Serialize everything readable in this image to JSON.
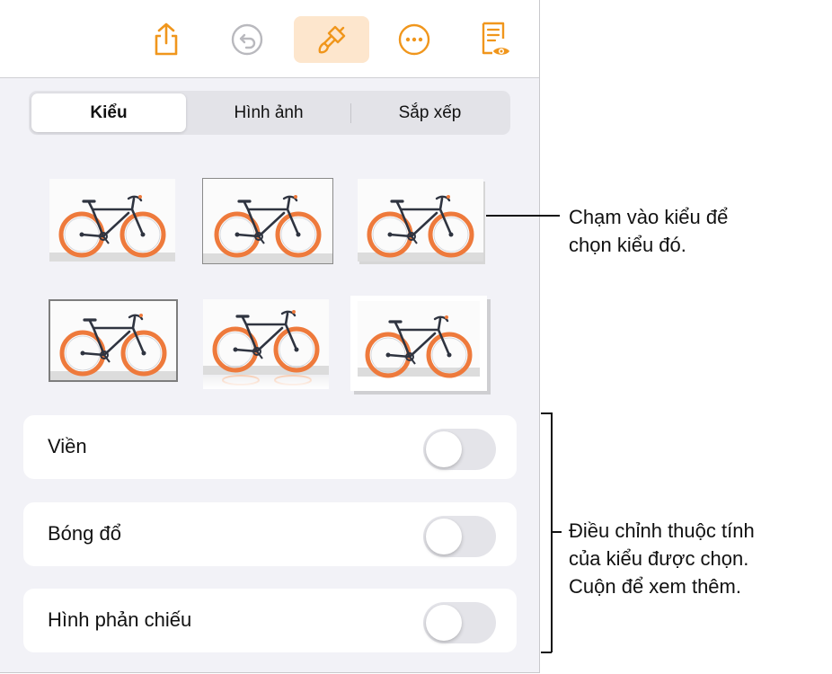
{
  "toolbar": {
    "icons": [
      "share-icon",
      "undo-icon",
      "paintbrush-icon",
      "more-icon",
      "reader-view-icon"
    ],
    "active_icon": "paintbrush-icon",
    "accent": "#f0961c",
    "active_bg": "#fde6cd"
  },
  "tabs": [
    {
      "label": "Kiểu",
      "selected": true
    },
    {
      "label": "Hình ảnh",
      "selected": false
    },
    {
      "label": "Sắp xếp",
      "selected": false
    }
  ],
  "styles": {
    "thumbnails": [
      "style-1",
      "style-2",
      "style-3",
      "style-4",
      "style-5",
      "style-6"
    ]
  },
  "options": [
    {
      "label": "Viền",
      "on": false
    },
    {
      "label": "Bóng đổ",
      "on": false
    },
    {
      "label": "Hình phản chiếu",
      "on": false
    }
  ],
  "callouts": {
    "styles_line1": "Chạm vào kiểu để",
    "styles_line2": "chọn kiểu đó.",
    "options_line1": "Điều chỉnh thuộc tính",
    "options_line2": "của kiểu được chọn.",
    "options_line3": "Cuộn để xem thêm."
  },
  "colors": {
    "wheel": "#ee7a3c",
    "frame": "#2f3440",
    "panel_bg": "#f2f2f7"
  }
}
